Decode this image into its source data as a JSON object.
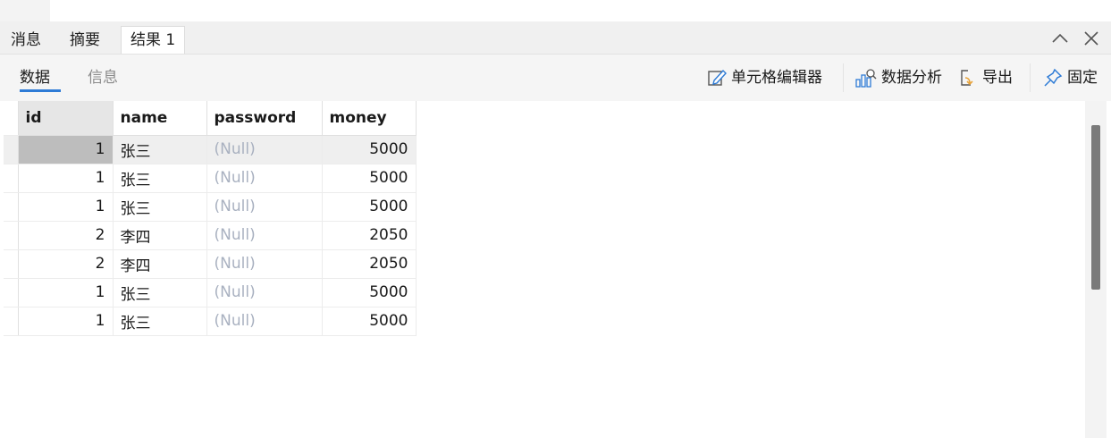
{
  "tabs": [
    {
      "label": "消息"
    },
    {
      "label": "摘要"
    },
    {
      "label": "结果 1"
    }
  ],
  "subtabs": [
    {
      "label": "数据"
    },
    {
      "label": "信息"
    }
  ],
  "toolbar": {
    "cell_editor": "单元格编辑器",
    "data_analysis": "数据分析",
    "export": "导出",
    "pin": "固定"
  },
  "grid": {
    "columns": [
      "id",
      "name",
      "password",
      "money"
    ],
    "rows": [
      {
        "id": "1",
        "name": "张三",
        "password": "(Null)",
        "money": "5000"
      },
      {
        "id": "1",
        "name": "张三",
        "password": "(Null)",
        "money": "5000"
      },
      {
        "id": "1",
        "name": "张三",
        "password": "(Null)",
        "money": "5000"
      },
      {
        "id": "2",
        "name": "李四",
        "password": "(Null)",
        "money": "2050"
      },
      {
        "id": "2",
        "name": "李四",
        "password": "(Null)",
        "money": "2050"
      },
      {
        "id": "1",
        "name": "张三",
        "password": "(Null)",
        "money": "5000"
      },
      {
        "id": "1",
        "name": "张三",
        "password": "(Null)",
        "money": "5000"
      }
    ],
    "selected_row": 0
  },
  "colors": {
    "accent": "#2e7bd6",
    "export_icon": "#e8a33a",
    "null_text": "#a9b1c0"
  },
  "icons": {
    "cell_editor": "pencil-edit-icon",
    "data_analysis": "bar-chart-search-icon",
    "export": "export-icon",
    "pin": "pin-icon",
    "collapse": "chevron-up-icon",
    "close": "close-icon"
  }
}
